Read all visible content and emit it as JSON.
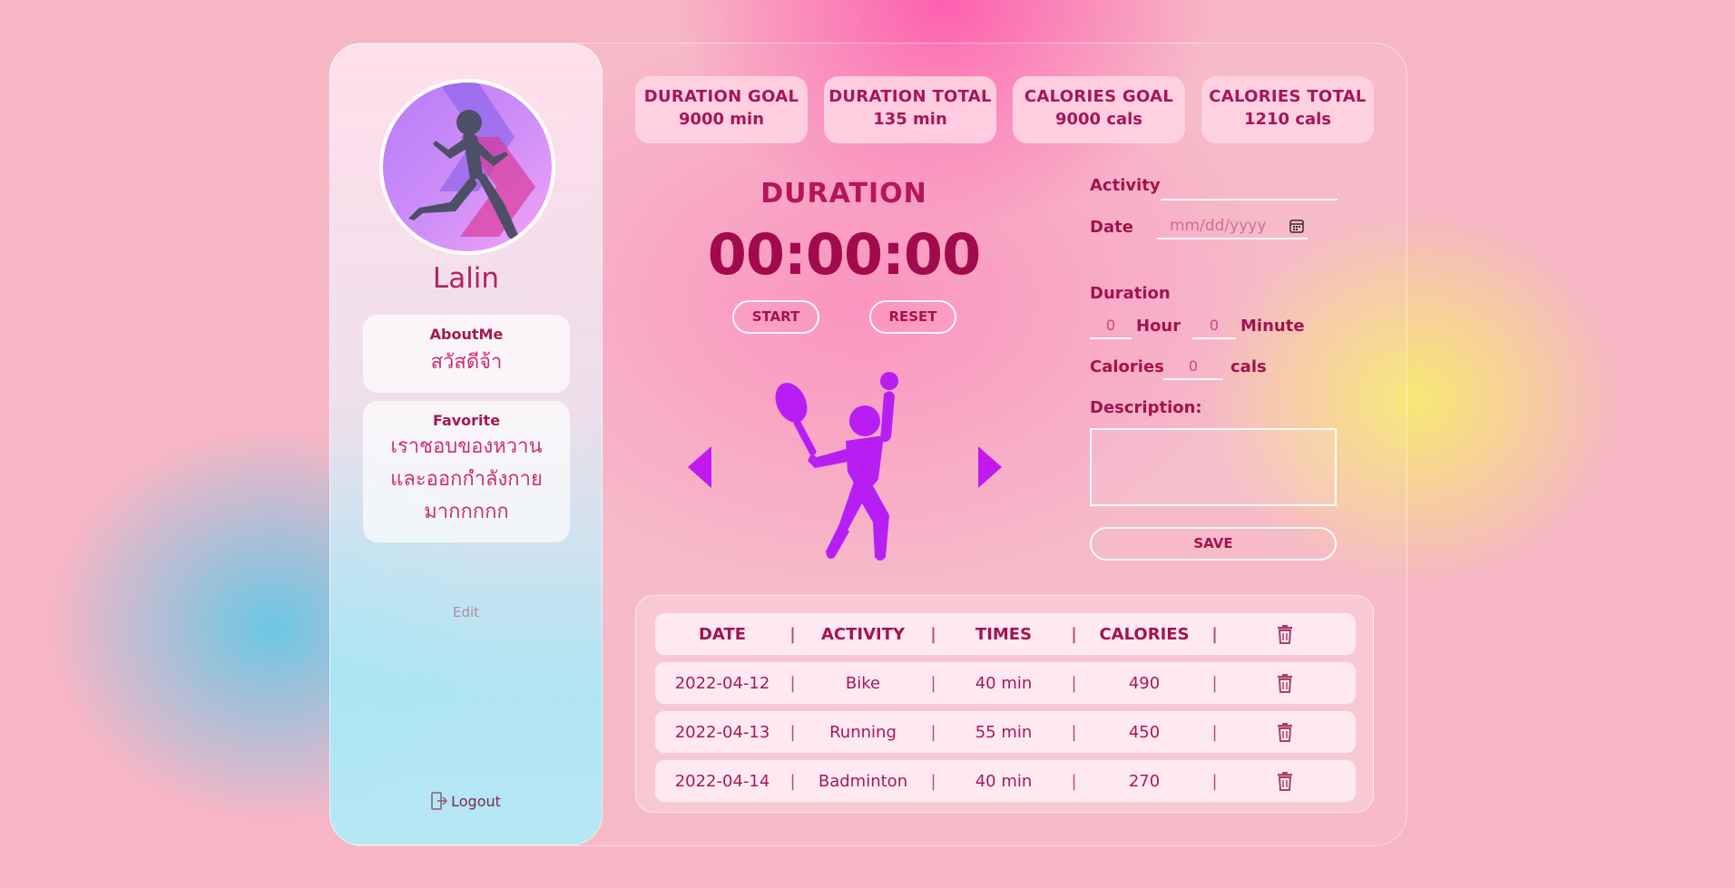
{
  "user": {
    "name": "Lalin",
    "about_title": "AboutMe",
    "about_text": "สวัสดีจ้า",
    "favorite_title": "Favorite",
    "favorite_lines": [
      "เราชอบของหวาน",
      "และออกกำลังกาย",
      "มากกกกก"
    ],
    "edit_label": "Edit",
    "logout_label": "Logout"
  },
  "stats": [
    {
      "label": "DURATION GOAL",
      "value": "9000 min"
    },
    {
      "label": "DURATION TOTAL",
      "value": "135 min"
    },
    {
      "label": "CALORIES GOAL",
      "value": "9000 cals"
    },
    {
      "label": "CALORIES TOTAL",
      "value": "1210 cals"
    }
  ],
  "timer": {
    "label": "DURATION",
    "value": "00:00:00",
    "start_label": "START",
    "reset_label": "RESET"
  },
  "form": {
    "activity_label": "Activity",
    "activity_value": "",
    "date_label": "Date",
    "date_placeholder": "mm/dd/yyyy",
    "duration_label": "Duration",
    "hour_value": "0",
    "hour_unit": "Hour",
    "minute_value": "0",
    "minute_unit": "Minute",
    "calories_label": "Calories",
    "calories_value": "0",
    "calories_unit": "cals",
    "description_label": "Description:",
    "save_label": "SAVE"
  },
  "table": {
    "headers": [
      "DATE",
      "ACTIVITY",
      "TIMES",
      "CALORIES"
    ],
    "separator": "|",
    "rows": [
      {
        "date": "2022-04-12",
        "activity": "Bike",
        "times": "40 min",
        "calories": "490"
      },
      {
        "date": "2022-04-13",
        "activity": "Running",
        "times": "55 min",
        "calories": "450"
      },
      {
        "date": "2022-04-14",
        "activity": "Badminton",
        "times": "40 min",
        "calories": "270"
      }
    ]
  },
  "icons": {
    "prev": "caret-left-icon",
    "next": "caret-right-icon",
    "sport": "tennis-player-icon",
    "delete": "trash-icon",
    "calendar": "calendar-icon",
    "logout": "logout-icon"
  },
  "colors": {
    "accent": "#a4124f",
    "arrow": "#c21aee",
    "sport_figure": "#b81ef4"
  }
}
